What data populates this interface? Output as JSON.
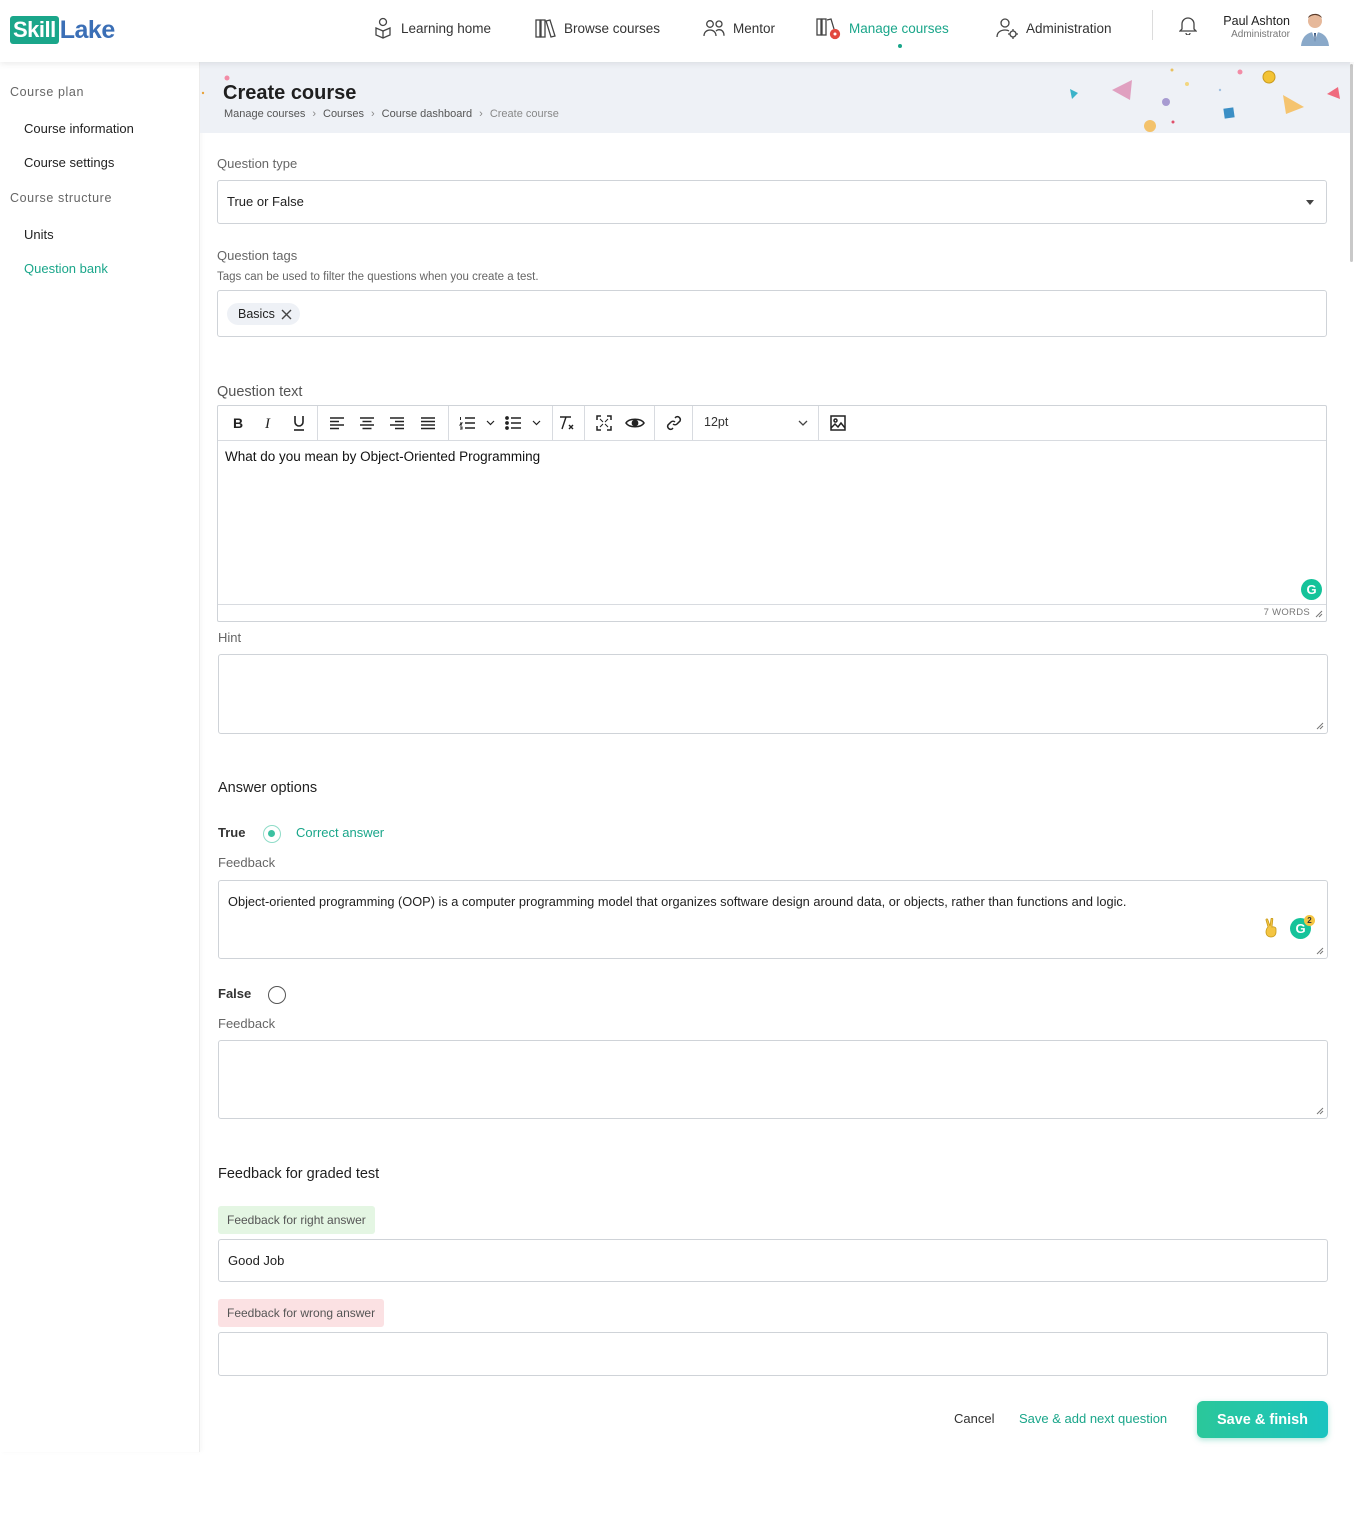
{
  "header": {
    "logo": {
      "part1": "Skill",
      "part2": "Lake"
    },
    "nav": [
      {
        "label": "Learning home"
      },
      {
        "label": "Browse courses"
      },
      {
        "label": "Mentor"
      },
      {
        "label": "Manage courses",
        "active": true
      },
      {
        "label": "Administration"
      }
    ],
    "user": {
      "name": "Paul Ashton",
      "role": "Administrator"
    }
  },
  "sidebar": {
    "sections": [
      {
        "heading": "Course plan",
        "items": [
          "Course information",
          "Course settings"
        ]
      },
      {
        "heading": "Course structure",
        "items": [
          "Units",
          "Question bank"
        ]
      }
    ],
    "active_item": "Question bank"
  },
  "page": {
    "title": "Create course",
    "breadcrumb": [
      "Manage courses",
      "Courses",
      "Course dashboard",
      "Create course"
    ]
  },
  "form": {
    "question_type": {
      "label": "Question type",
      "value": "True or False"
    },
    "question_tags": {
      "label": "Question tags",
      "help": "Tags can be used to filter the questions when you create a test.",
      "tags": [
        "Basics"
      ]
    },
    "question_text": {
      "label": "Question text",
      "font_size": "12pt",
      "content": "What do you mean by Object-Oriented Programming",
      "word_count": "7 WORDS"
    },
    "hint": {
      "label": "Hint",
      "value": ""
    },
    "answer_options": {
      "title": "Answer options",
      "options": [
        {
          "label": "True",
          "checked": true,
          "correct_text": "Correct answer",
          "feedback_label": "Feedback",
          "feedback": "Object-oriented programming (OOP) is a computer programming model that organizes software design around data, or objects, rather than functions and logic."
        },
        {
          "label": "False",
          "checked": false,
          "feedback_label": "Feedback",
          "feedback": ""
        }
      ]
    },
    "graded_feedback": {
      "title": "Feedback for graded test",
      "right_label": "Feedback for right answer",
      "right_value": "Good Job",
      "wrong_label": "Feedback for wrong answer",
      "wrong_value": ""
    },
    "grammarly_badge": "2",
    "grammarly_letter": "G"
  },
  "actions": {
    "cancel": "Cancel",
    "save_next": "Save & add next question",
    "save_finish": "Save & finish"
  },
  "colors": {
    "accent": "#1aa68a",
    "brand_blue": "#3b6fb6",
    "banner_bg": "#eef1f6",
    "right_pill": "#e4f6e3",
    "wrong_pill": "#fbe1e3"
  }
}
